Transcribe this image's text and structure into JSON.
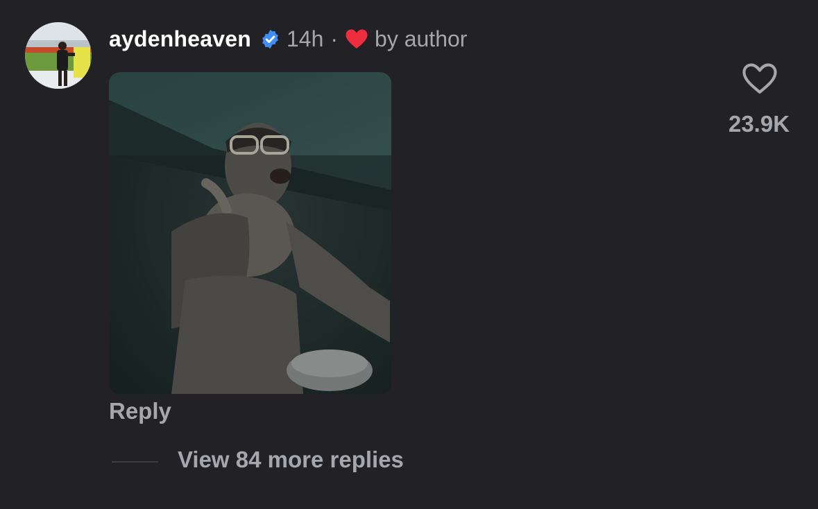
{
  "comment": {
    "username": "aydenheaven",
    "timestamp": "14h",
    "separator": "·",
    "liked_by": "by author",
    "reply_label": "Reply",
    "view_replies": "View 84 more replies",
    "like_count": "23.9K",
    "icons": {
      "verified": "verified-badge-icon",
      "author_like": "heart-filled-icon",
      "like": "heart-outline-icon"
    },
    "colors": {
      "background": "#212126",
      "username": "#ffffff",
      "secondary_text": "#a6a7ad",
      "verified_blue": "#3f8ef5",
      "heart_red": "#ef2d3f"
    }
  }
}
